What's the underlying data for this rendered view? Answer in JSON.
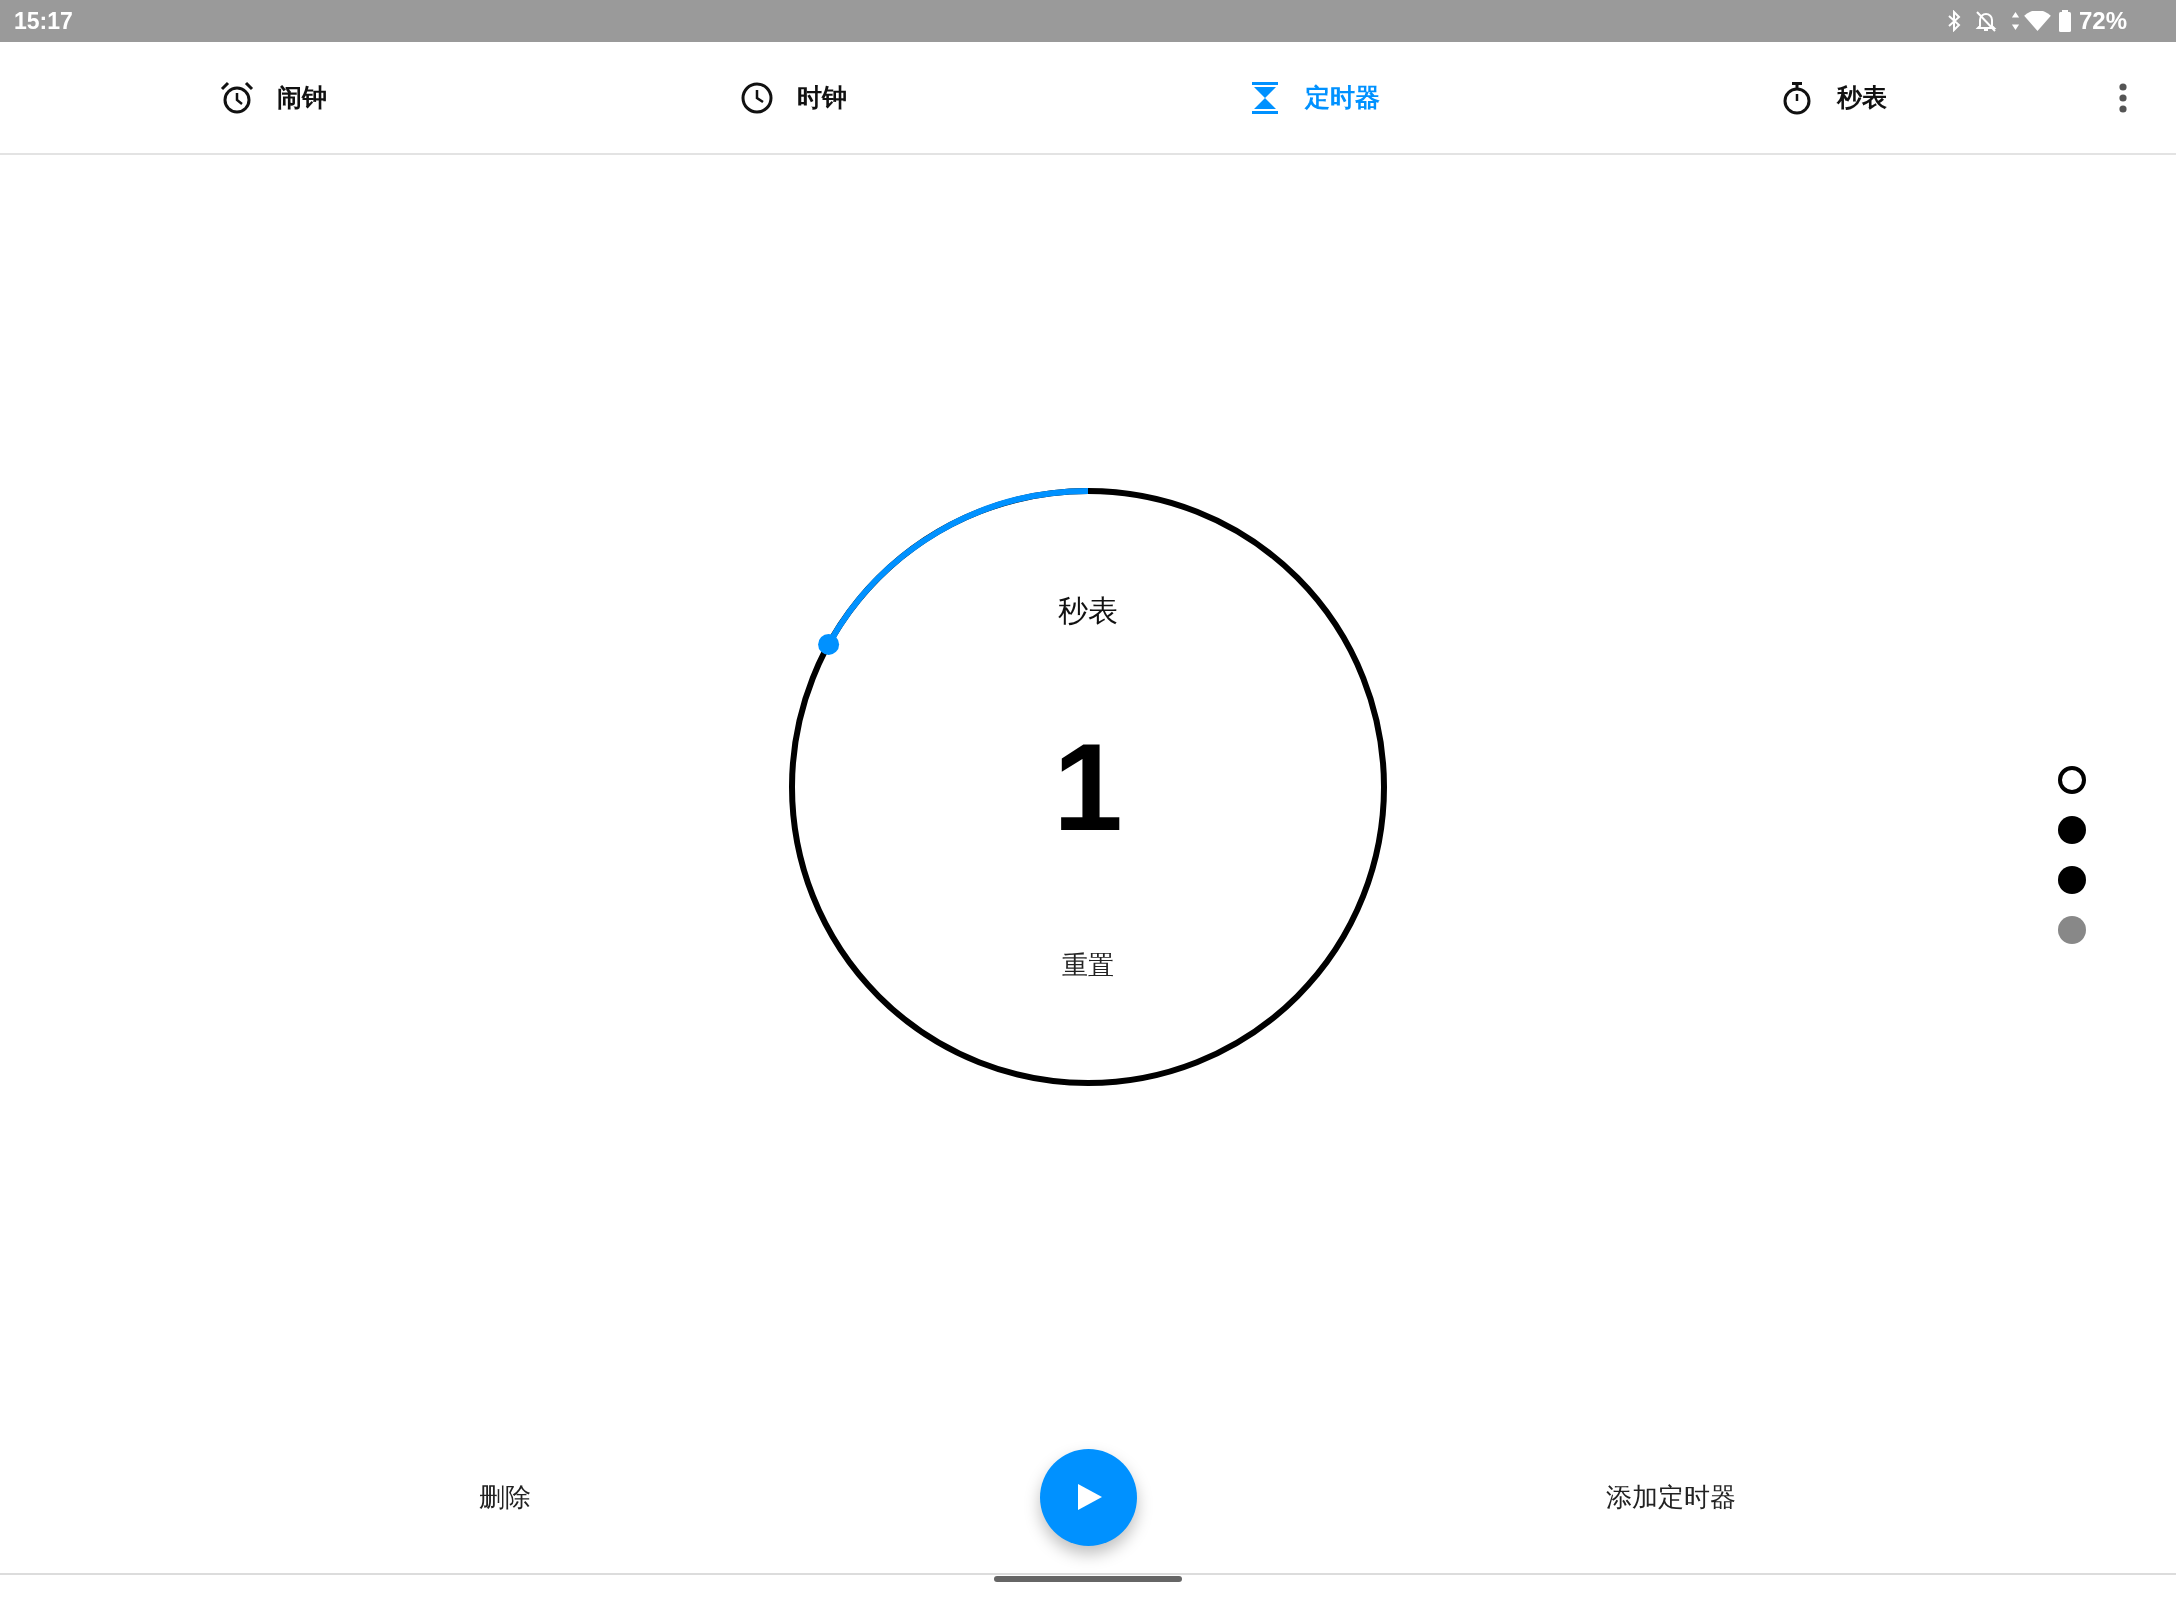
{
  "status_bar": {
    "time": "15:17",
    "battery_text": "72%"
  },
  "tabs": [
    {
      "kind": "alarm",
      "label": "闹钟",
      "selected": false
    },
    {
      "kind": "clock",
      "label": "时钟",
      "selected": false
    },
    {
      "kind": "timer",
      "label": "定时器",
      "selected": true
    },
    {
      "kind": "stopwatch",
      "label": "秒表",
      "selected": false
    }
  ],
  "timer": {
    "label": "秒表",
    "time": "1",
    "level": 0.17,
    "reset": "重置"
  },
  "page_indicator": [
    {
      "selected": true,
      "color": "#000000"
    },
    {
      "selected": false,
      "color": "#000000"
    },
    {
      "selected": false,
      "color": "#000000"
    },
    {
      "selected": false,
      "color": "#888888"
    }
  ],
  "actions": {
    "delete": "删除",
    "add": "添加定时器"
  }
}
